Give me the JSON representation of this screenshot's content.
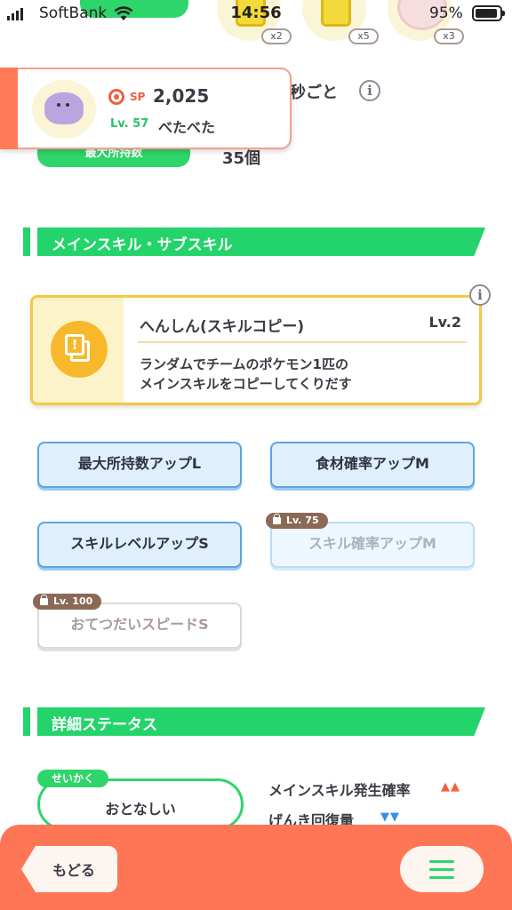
{
  "status_bar": {
    "carrier": "SoftBank",
    "time": "14:56",
    "battery": "95%"
  },
  "top_items": [
    {
      "count": "x2"
    },
    {
      "count": "x5"
    },
    {
      "count": "x3"
    }
  ],
  "pokemon": {
    "sp_label": "SP",
    "sp_value": "2,025",
    "level": "Lv. 57",
    "name": "べたべた"
  },
  "header_info": {
    "partial_text": "秒ごと",
    "max_label": "最大所持数",
    "max_value": "35個"
  },
  "skills_section": {
    "title": "メインスキル・サブスキル"
  },
  "main_skill": {
    "name": "へんしん(スキルコピー)",
    "level": "Lv.2",
    "icon_glyph": "!",
    "description_line1": "ランダムでチームのポケモン1匹の",
    "description_line2": "メインスキルをコピーしてくりだす"
  },
  "sub_skills": [
    {
      "label": "最大所持数アップL",
      "locked": false
    },
    {
      "label": "食材確率アップM",
      "locked": false
    },
    {
      "label": "スキルレベルアップS",
      "locked": false
    },
    {
      "label": "スキル確率アップM",
      "locked": true,
      "unlock_level": "Lv. 75"
    },
    {
      "label": "おてつだいスピードS",
      "locked": true,
      "unlock_level": "Lv. 100"
    }
  ],
  "detail_section": {
    "title": "詳細ステータス"
  },
  "nature": {
    "tag": "せいかく",
    "value": "おとなしい",
    "effects": [
      {
        "label": "メインスキル発生確率",
        "arrows": "▲▲",
        "direction": "up",
        "color": "#f0613f"
      },
      {
        "label": "げんき回復量",
        "arrows": "▼▼",
        "direction": "down",
        "color": "#3a8fe8"
      }
    ]
  },
  "bottom_bar": {
    "back_label": "もどる",
    "menu_icon": "hamburger-menu-icon"
  },
  "colors": {
    "accent_green": "#23d46a",
    "bottom_bar": "#ff7657",
    "skill_border": "#f5c842"
  }
}
